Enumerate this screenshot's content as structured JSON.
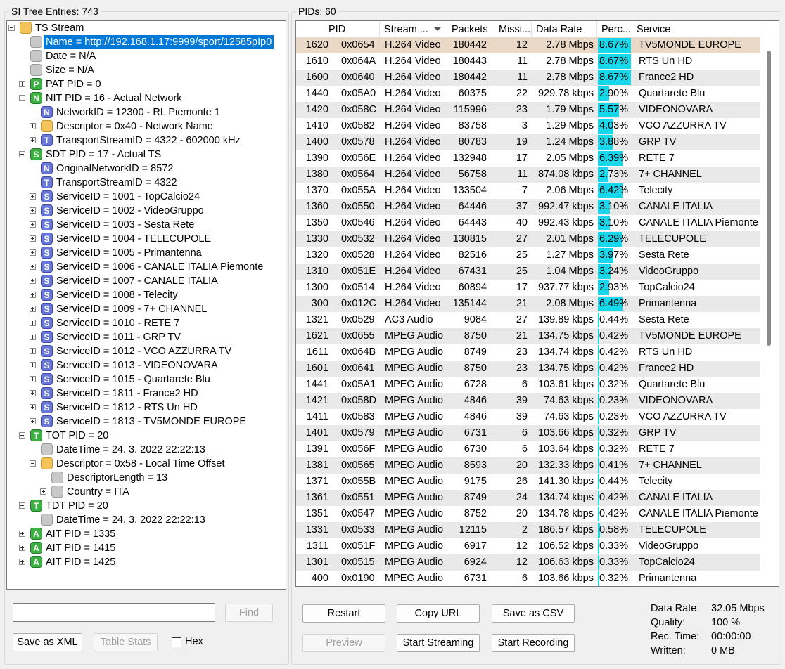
{
  "left_panel": {
    "title": "SI Tree Entries: 743",
    "find_button": "Find",
    "save_xml_button": "Save as XML",
    "table_stats_button": "Table Stats",
    "hex_label": "Hex",
    "tree": [
      {
        "level": 0,
        "icon": "folder",
        "expander": "open",
        "label": "TS Stream"
      },
      {
        "level": 1,
        "icon": "leaf",
        "expander": "none",
        "label": "Name = http://192.168.1.17:9999/sport/12585pIp0",
        "selected": true
      },
      {
        "level": 1,
        "icon": "leaf",
        "expander": "none",
        "label": "Date = N/A"
      },
      {
        "level": 1,
        "icon": "leaf",
        "expander": "none",
        "label": "Size = N/A"
      },
      {
        "level": 1,
        "icon": "P",
        "color": "green",
        "expander": "closed",
        "label": "PAT PID = 0"
      },
      {
        "level": 1,
        "icon": "N",
        "color": "green",
        "expander": "open",
        "label": "NIT PID = 16 - Actual Network"
      },
      {
        "level": 2,
        "icon": "N",
        "color": "blue",
        "expander": "none",
        "label": "NetworkID = 12300 - RL Piemonte 1"
      },
      {
        "level": 2,
        "icon": "folder",
        "expander": "closed",
        "label": "Descriptor = 0x40 - Network Name"
      },
      {
        "level": 2,
        "icon": "T",
        "color": "blue",
        "expander": "closed",
        "label": "TransportStreamID = 4322 - 602000 kHz"
      },
      {
        "level": 1,
        "icon": "S",
        "color": "green",
        "expander": "open",
        "label": "SDT PID = 17 - Actual TS"
      },
      {
        "level": 2,
        "icon": "N",
        "color": "blue",
        "expander": "none",
        "label": "OriginalNetworkID = 8572"
      },
      {
        "level": 2,
        "icon": "T",
        "color": "blue",
        "expander": "none",
        "label": "TransportStreamID = 4322"
      },
      {
        "level": 2,
        "icon": "S",
        "color": "blue",
        "expander": "closed",
        "label": "ServiceID = 1001 - TopCalcio24"
      },
      {
        "level": 2,
        "icon": "S",
        "color": "blue",
        "expander": "closed",
        "label": "ServiceID = 1002 - VideoGruppo"
      },
      {
        "level": 2,
        "icon": "S",
        "color": "blue",
        "expander": "closed",
        "label": "ServiceID = 1003 - Sesta Rete"
      },
      {
        "level": 2,
        "icon": "S",
        "color": "blue",
        "expander": "closed",
        "label": "ServiceID = 1004 - TELECUPOLE"
      },
      {
        "level": 2,
        "icon": "S",
        "color": "blue",
        "expander": "closed",
        "label": "ServiceID = 1005 - Primantenna"
      },
      {
        "level": 2,
        "icon": "S",
        "color": "blue",
        "expander": "closed",
        "label": "ServiceID = 1006 - CANALE ITALIA Piemonte"
      },
      {
        "level": 2,
        "icon": "S",
        "color": "blue",
        "expander": "closed",
        "label": "ServiceID = 1007 - CANALE ITALIA"
      },
      {
        "level": 2,
        "icon": "S",
        "color": "blue",
        "expander": "closed",
        "label": "ServiceID = 1008 - Telecity"
      },
      {
        "level": 2,
        "icon": "S",
        "color": "blue",
        "expander": "closed",
        "label": "ServiceID = 1009 - 7+ CHANNEL"
      },
      {
        "level": 2,
        "icon": "S",
        "color": "blue",
        "expander": "closed",
        "label": "ServiceID = 1010 - RETE 7"
      },
      {
        "level": 2,
        "icon": "S",
        "color": "blue",
        "expander": "closed",
        "label": "ServiceID = 1011 - GRP TV"
      },
      {
        "level": 2,
        "icon": "S",
        "color": "blue",
        "expander": "closed",
        "label": "ServiceID = 1012 - VCO AZZURRA TV"
      },
      {
        "level": 2,
        "icon": "S",
        "color": "blue",
        "expander": "closed",
        "label": "ServiceID = 1013 - VIDEONOVARA"
      },
      {
        "level": 2,
        "icon": "S",
        "color": "blue",
        "expander": "closed",
        "label": "ServiceID = 1015 - Quartarete Blu"
      },
      {
        "level": 2,
        "icon": "S",
        "color": "blue",
        "expander": "closed",
        "label": "ServiceID = 1811 - France2 HD"
      },
      {
        "level": 2,
        "icon": "S",
        "color": "blue",
        "expander": "closed",
        "label": "ServiceID = 1812 - RTS Un HD"
      },
      {
        "level": 2,
        "icon": "S",
        "color": "blue",
        "expander": "closed",
        "label": "ServiceID = 1813 - TV5MONDE EUROPE"
      },
      {
        "level": 1,
        "icon": "T",
        "color": "green",
        "expander": "open",
        "label": "TOT PID = 20"
      },
      {
        "level": 2,
        "icon": "leaf",
        "expander": "none",
        "label": "DateTime = 24. 3. 2022 22:22:13"
      },
      {
        "level": 2,
        "icon": "folder",
        "expander": "open",
        "label": "Descriptor = 0x58 - Local Time Offset"
      },
      {
        "level": 3,
        "icon": "leaf",
        "expander": "none",
        "label": "DescriptorLength = 13"
      },
      {
        "level": 3,
        "icon": "leaf",
        "expander": "closed",
        "label": "Country = ITA"
      },
      {
        "level": 1,
        "icon": "T",
        "color": "green",
        "expander": "open",
        "label": "TDT PID = 20"
      },
      {
        "level": 2,
        "icon": "leaf",
        "expander": "none",
        "label": "DateTime = 24. 3. 2022 22:22:13"
      },
      {
        "level": 1,
        "icon": "A",
        "color": "green",
        "expander": "closed",
        "label": "AIT PID = 1335"
      },
      {
        "level": 1,
        "icon": "A",
        "color": "green",
        "expander": "closed",
        "label": "AIT PID = 1415"
      },
      {
        "level": 1,
        "icon": "A",
        "color": "green",
        "expander": "closed",
        "label": "AIT PID = 1425"
      }
    ]
  },
  "right_panel": {
    "title": "PIDs: 60",
    "columns": [
      "PID",
      "Stream ...",
      "Packets",
      "Missi...",
      "Data Rate",
      "Perc...",
      "Service"
    ],
    "rows": [
      [
        "1620",
        "0x0654",
        "H.264 Video",
        "180442",
        "12",
        "2.78 Mbps",
        "8.67%",
        "TV5MONDE EUROPE"
      ],
      [
        "1610",
        "0x064A",
        "H.264 Video",
        "180443",
        "11",
        "2.78 Mbps",
        "8.67%",
        "RTS Un HD"
      ],
      [
        "1600",
        "0x0640",
        "H.264 Video",
        "180442",
        "11",
        "2.78 Mbps",
        "8.67%",
        "France2 HD"
      ],
      [
        "1440",
        "0x05A0",
        "H.264 Video",
        "60375",
        "22",
        "929.78 kbps",
        "2.90%",
        "Quartarete Blu"
      ],
      [
        "1420",
        "0x058C",
        "H.264 Video",
        "115996",
        "23",
        "1.79 Mbps",
        "5.57%",
        "VIDEONOVARA"
      ],
      [
        "1410",
        "0x0582",
        "H.264 Video",
        "83758",
        "3",
        "1.29 Mbps",
        "4.03%",
        "VCO AZZURRA TV"
      ],
      [
        "1400",
        "0x0578",
        "H.264 Video",
        "80783",
        "19",
        "1.24 Mbps",
        "3.88%",
        "GRP TV"
      ],
      [
        "1390",
        "0x056E",
        "H.264 Video",
        "132948",
        "17",
        "2.05 Mbps",
        "6.39%",
        "RETE 7"
      ],
      [
        "1380",
        "0x0564",
        "H.264 Video",
        "56758",
        "11",
        "874.08 kbps",
        "2.73%",
        "7+ CHANNEL"
      ],
      [
        "1370",
        "0x055A",
        "H.264 Video",
        "133504",
        "7",
        "2.06 Mbps",
        "6.42%",
        "Telecity"
      ],
      [
        "1360",
        "0x0550",
        "H.264 Video",
        "64446",
        "37",
        "992.47 kbps",
        "3.10%",
        "CANALE ITALIA"
      ],
      [
        "1350",
        "0x0546",
        "H.264 Video",
        "64443",
        "40",
        "992.43 kbps",
        "3.10%",
        "CANALE ITALIA Piemonte"
      ],
      [
        "1330",
        "0x0532",
        "H.264 Video",
        "130815",
        "27",
        "2.01 Mbps",
        "6.29%",
        "TELECUPOLE"
      ],
      [
        "1320",
        "0x0528",
        "H.264 Video",
        "82516",
        "25",
        "1.27 Mbps",
        "3.97%",
        "Sesta Rete"
      ],
      [
        "1310",
        "0x051E",
        "H.264 Video",
        "67431",
        "25",
        "1.04 Mbps",
        "3.24%",
        "VideoGruppo"
      ],
      [
        "1300",
        "0x0514",
        "H.264 Video",
        "60894",
        "17",
        "937.77 kbps",
        "2.93%",
        "TopCalcio24"
      ],
      [
        "300",
        "0x012C",
        "H.264 Video",
        "135144",
        "21",
        "2.08 Mbps",
        "6.49%",
        "Primantenna"
      ],
      [
        "1321",
        "0x0529",
        "AC3 Audio",
        "9084",
        "27",
        "139.89 kbps",
        "0.44%",
        "Sesta Rete"
      ],
      [
        "1621",
        "0x0655",
        "MPEG Audio",
        "8750",
        "21",
        "134.75 kbps",
        "0.42%",
        "TV5MONDE EUROPE"
      ],
      [
        "1611",
        "0x064B",
        "MPEG Audio",
        "8749",
        "23",
        "134.74 kbps",
        "0.42%",
        "RTS Un HD"
      ],
      [
        "1601",
        "0x0641",
        "MPEG Audio",
        "8750",
        "23",
        "134.75 kbps",
        "0.42%",
        "France2 HD"
      ],
      [
        "1441",
        "0x05A1",
        "MPEG Audio",
        "6728",
        "6",
        "103.61 kbps",
        "0.32%",
        "Quartarete Blu"
      ],
      [
        "1421",
        "0x058D",
        "MPEG Audio",
        "4846",
        "39",
        "74.63 kbps",
        "0.23%",
        "VIDEONOVARA"
      ],
      [
        "1411",
        "0x0583",
        "MPEG Audio",
        "4846",
        "39",
        "74.63 kbps",
        "0.23%",
        "VCO AZZURRA TV"
      ],
      [
        "1401",
        "0x0579",
        "MPEG Audio",
        "6731",
        "6",
        "103.66 kbps",
        "0.32%",
        "GRP TV"
      ],
      [
        "1391",
        "0x056F",
        "MPEG Audio",
        "6730",
        "6",
        "103.64 kbps",
        "0.32%",
        "RETE 7"
      ],
      [
        "1381",
        "0x0565",
        "MPEG Audio",
        "8593",
        "20",
        "132.33 kbps",
        "0.41%",
        "7+ CHANNEL"
      ],
      [
        "1371",
        "0x055B",
        "MPEG Audio",
        "9175",
        "26",
        "141.30 kbps",
        "0.44%",
        "Telecity"
      ],
      [
        "1361",
        "0x0551",
        "MPEG Audio",
        "8749",
        "24",
        "134.74 kbps",
        "0.42%",
        "CANALE ITALIA"
      ],
      [
        "1351",
        "0x0547",
        "MPEG Audio",
        "8752",
        "20",
        "134.78 kbps",
        "0.42%",
        "CANALE ITALIA Piemonte"
      ],
      [
        "1331",
        "0x0533",
        "MPEG Audio",
        "12115",
        "2",
        "186.57 kbps",
        "0.58%",
        "TELECUPOLE"
      ],
      [
        "1311",
        "0x051F",
        "MPEG Audio",
        "6917",
        "12",
        "106.52 kbps",
        "0.33%",
        "VideoGruppo"
      ],
      [
        "1301",
        "0x0515",
        "MPEG Audio",
        "6924",
        "12",
        "106.63 kbps",
        "0.33%",
        "TopCalcio24"
      ],
      [
        "400",
        "0x0190",
        "MPEG Audio",
        "6731",
        "6",
        "103.66 kbps",
        "0.32%",
        "Primantenna"
      ]
    ],
    "buttons": {
      "restart": "Restart",
      "copy_url": "Copy URL",
      "save_csv": "Save as CSV",
      "preview": "Preview",
      "start_streaming": "Start Streaming",
      "start_recording": "Start Recording"
    },
    "stats": {
      "data_rate_label": "Data Rate:",
      "data_rate_value": "32.05 Mbps",
      "quality_label": "Quality:",
      "quality_value": "100 %",
      "rec_time_label": "Rec. Time:",
      "rec_time_value": "00:00:00",
      "written_label": "Written:",
      "written_value": "0 MB"
    }
  },
  "colors": {
    "selection": "#0078d7",
    "percent_bar": "#17d7ea",
    "selected_row": "#ead9c7",
    "alt_row": "#e9e9e9",
    "tree_icon_green": "#3cb043",
    "tree_icon_blue": "#6a78d8",
    "tree_icon_folder": "#f4c35a",
    "tree_icon_leaf": "#c8c8c8"
  }
}
